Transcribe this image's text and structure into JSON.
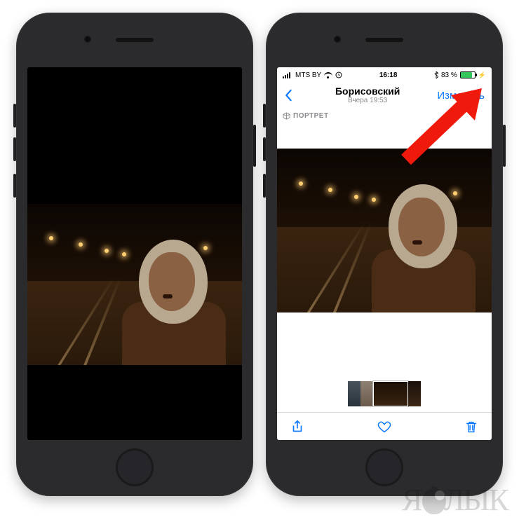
{
  "status": {
    "carrier": "MTS BY",
    "time": "16:18",
    "battery_pct": "83 %",
    "battery_fill": 83
  },
  "nav": {
    "title": "Борисовский",
    "subtitle": "Вчера 19:53",
    "edit": "Изменить"
  },
  "badge": {
    "label": "ПОРТРЕТ"
  },
  "watermark": {
    "pre": "Я",
    "post": "ЛЫК"
  }
}
